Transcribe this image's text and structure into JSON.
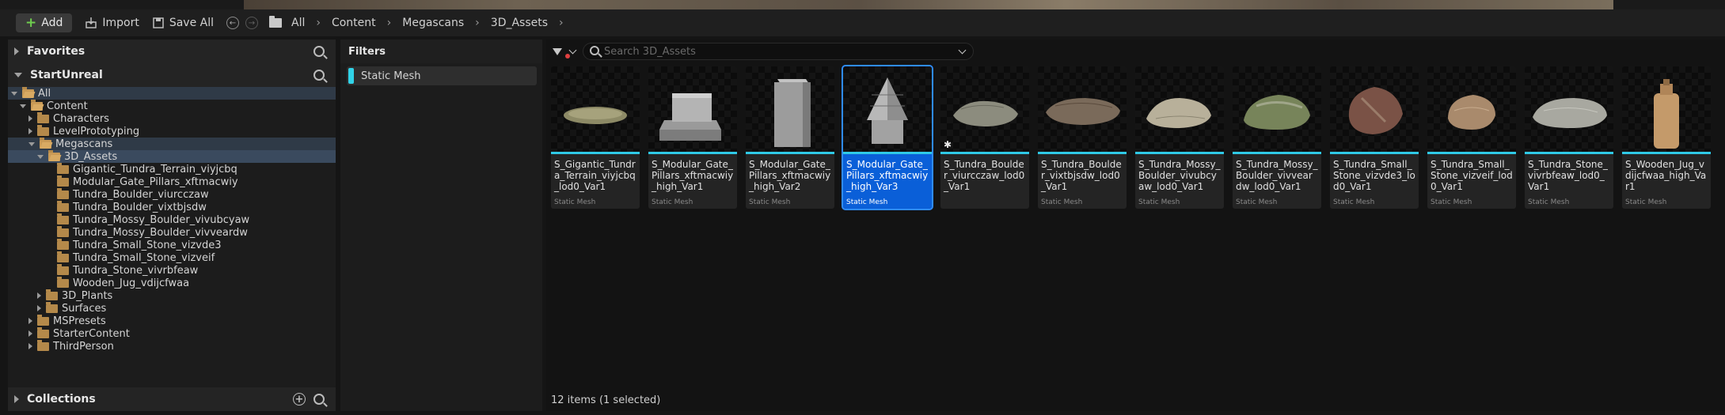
{
  "toolbar": {
    "add_label": "Add",
    "import_label": "Import",
    "save_all_label": "Save All",
    "breadcrumbs": [
      "All",
      "Content",
      "Megascans",
      "3D_Assets"
    ]
  },
  "favorites": {
    "title": "Favorites"
  },
  "project": {
    "title": "StartUnreal"
  },
  "tree": [
    {
      "label": "All",
      "depth": 0,
      "expand": "down",
      "state": "hl"
    },
    {
      "label": "Content",
      "depth": 1,
      "expand": "down",
      "state": ""
    },
    {
      "label": "Characters",
      "depth": 2,
      "expand": "right",
      "state": ""
    },
    {
      "label": "LevelPrototyping",
      "depth": 2,
      "expand": "right",
      "state": ""
    },
    {
      "label": "Megascans",
      "depth": 2,
      "expand": "down",
      "state": "hl"
    },
    {
      "label": "3D_Assets",
      "depth": 3,
      "expand": "down",
      "state": "sel"
    },
    {
      "label": "Gigantic_Tundra_Terrain_viyjcbq",
      "depth": 4,
      "expand": "none",
      "state": ""
    },
    {
      "label": "Modular_Gate_Pillars_xftmacwiy",
      "depth": 4,
      "expand": "none",
      "state": ""
    },
    {
      "label": "Tundra_Boulder_viurcczaw",
      "depth": 4,
      "expand": "none",
      "state": ""
    },
    {
      "label": "Tundra_Boulder_vixtbjsdw",
      "depth": 4,
      "expand": "none",
      "state": ""
    },
    {
      "label": "Tundra_Mossy_Boulder_vivubcyaw",
      "depth": 4,
      "expand": "none",
      "state": ""
    },
    {
      "label": "Tundra_Mossy_Boulder_vivveardw",
      "depth": 4,
      "expand": "none",
      "state": ""
    },
    {
      "label": "Tundra_Small_Stone_vizvde3",
      "depth": 4,
      "expand": "none",
      "state": ""
    },
    {
      "label": "Tundra_Small_Stone_vizveif",
      "depth": 4,
      "expand": "none",
      "state": ""
    },
    {
      "label": "Tundra_Stone_vivrbfeaw",
      "depth": 4,
      "expand": "none",
      "state": ""
    },
    {
      "label": "Wooden_Jug_vdijcfwaa",
      "depth": 4,
      "expand": "none",
      "state": ""
    },
    {
      "label": "3D_Plants",
      "depth": 3,
      "expand": "right",
      "state": ""
    },
    {
      "label": "Surfaces",
      "depth": 3,
      "expand": "right",
      "state": ""
    },
    {
      "label": "MSPresets",
      "depth": 2,
      "expand": "right",
      "state": ""
    },
    {
      "label": "StarterContent",
      "depth": 2,
      "expand": "right",
      "state": ""
    },
    {
      "label": "ThirdPerson",
      "depth": 2,
      "expand": "right",
      "state": ""
    }
  ],
  "collections": {
    "title": "Collections"
  },
  "filters": {
    "title": "Filters",
    "active_filter": "Static Mesh",
    "active_filter_color": "#31d3e8"
  },
  "search": {
    "placeholder": "Search 3D_Assets"
  },
  "assets": [
    {
      "name": "S_Gigantic_Tundra_Terrain_viyjcbq_lod0_Var1",
      "type": "Static Mesh",
      "selected": false,
      "thumb": "terrain"
    },
    {
      "name": "S_Modular_Gate_Pillars_xftmacwiy_high_Var1",
      "type": "Static Mesh",
      "selected": false,
      "thumb": "pillar-base"
    },
    {
      "name": "S_Modular_Gate_Pillars_xftmacwiy_high_Var2",
      "type": "Static Mesh",
      "selected": false,
      "thumb": "pillar-column"
    },
    {
      "name": "S_Modular_Gate_Pillars_xftmacwiy_high_Var3",
      "type": "Static Mesh",
      "selected": true,
      "thumb": "pillar-top"
    },
    {
      "name": "S_Tundra_Boulder_viurcczaw_lod0_Var1",
      "type": "",
      "selected": false,
      "thumb": "boulder-grey",
      "modified": true
    },
    {
      "name": "S_Tundra_Boulder_vixtbjsdw_lod0_Var1",
      "type": "Static Mesh",
      "selected": false,
      "thumb": "boulder-brown"
    },
    {
      "name": "S_Tundra_Mossy_Boulder_vivubcyaw_lod0_Var1",
      "type": "Static Mesh",
      "selected": false,
      "thumb": "mossy-light"
    },
    {
      "name": "S_Tundra_Mossy_Boulder_vivveardw_lod0_Var1",
      "type": "Static Mesh",
      "selected": false,
      "thumb": "mossy-green"
    },
    {
      "name": "S_Tundra_Small_Stone_vizvde3_lod0_Var1",
      "type": "Static Mesh",
      "selected": false,
      "thumb": "stone-red"
    },
    {
      "name": "S_Tundra_Small_Stone_vizveif_lod0_Var1",
      "type": "Static Mesh",
      "selected": false,
      "thumb": "stone-tan"
    },
    {
      "name": "S_Tundra_Stone_vivrbfeaw_lod0_Var1",
      "type": "Static Mesh",
      "selected": false,
      "thumb": "stone-pale"
    },
    {
      "name": "S_Wooden_Jug_vdijcfwaa_high_Var1",
      "type": "Static Mesh",
      "selected": false,
      "thumb": "jug"
    }
  ],
  "status": "12 items (1 selected)",
  "colors": {
    "accent_cyan": "#2fc9e6",
    "selection_blue": "#0a5fd8",
    "folder": "#b4894a",
    "add_plus": "#6fce4f"
  }
}
